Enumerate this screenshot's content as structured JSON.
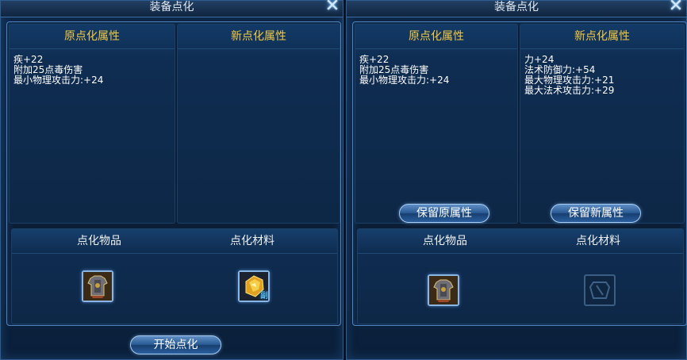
{
  "left_window": {
    "title": "装备点化",
    "original_header": "原点化属性",
    "new_header": "新点化属性",
    "original_stats": [
      "疾+22",
      "附加25点毒伤害",
      "最小物理攻击力:+24"
    ],
    "new_stats": [],
    "item_label": "点化物品",
    "material_label": "点化材料",
    "start_button": "开始点化",
    "item_slot": {
      "icon": "armor-icon",
      "filled": true
    },
    "material_slot": {
      "icon": "gold-ore-icon",
      "badge": "副",
      "filled": true
    }
  },
  "right_window": {
    "title": "装备点化",
    "original_header": "原点化属性",
    "new_header": "新点化属性",
    "original_stats": [
      "疾+22",
      "附加25点毒伤害",
      "最小物理攻击力:+24"
    ],
    "new_stats": [
      "力+24",
      "法术防御力:+54",
      "最大物理攻击力:+21",
      "最大法术攻击力:+29"
    ],
    "keep_original_button": "保留原属性",
    "keep_new_button": "保留新属性",
    "item_label": "点化物品",
    "material_label": "点化材料",
    "item_slot": {
      "icon": "armor-icon",
      "filled": true
    },
    "material_slot": {
      "icon": "empty-slot-icon",
      "filled": false
    }
  },
  "colors": {
    "header_gold": "#f5c842",
    "border_blue": "#4f83bd",
    "panel_bg": "#0d2746"
  }
}
